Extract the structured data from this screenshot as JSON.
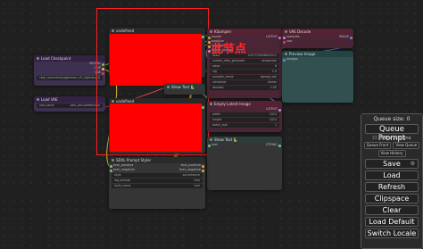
{
  "nodes": {
    "load_checkpoint": {
      "title": "Load Checkpoint",
      "outputs": [
        "MODEL",
        "CLIP",
        "VAE"
      ],
      "ckpt_label": "ckpt_name",
      "ckpt_value": "sdxl\\juggernaut_v9_Lightning_fp16.safetensors"
    },
    "load_vae": {
      "title": "Load VAE",
      "output": "VAE",
      "vae_label": "vae_name",
      "vae_value": "sdxl_vae.safetensors"
    },
    "undefined_top": {
      "title": "undefined",
      "output": "STRING"
    },
    "undefined_bottom": {
      "title": "undefined",
      "output": "STRING"
    },
    "ksampler": {
      "title": "KSampler",
      "inputs": [
        "model",
        "positive",
        "negative",
        "latent_image"
      ],
      "output": "LATENT",
      "widgets": [
        {
          "label": "seed",
          "value": "1027378458832011"
        },
        {
          "label": "control_after_generate",
          "value": "randomize"
        },
        {
          "label": "steps",
          "value": "6"
        },
        {
          "label": "cfg",
          "value": "1.5"
        },
        {
          "label": "sampler_name",
          "value": "dpmpp_sde"
        },
        {
          "label": "scheduler",
          "value": "karras"
        },
        {
          "label": "denoise",
          "value": "1.00"
        }
      ]
    },
    "vae_decode": {
      "title": "VAE Decode",
      "inputs": [
        "samples",
        "vae"
      ],
      "output": "IMAGE"
    },
    "preview_image": {
      "title": "Preview Image",
      "input": "images"
    },
    "show_text_1": {
      "title": "Show Text 🐍",
      "input": "text",
      "output": "STRING"
    },
    "empty_latent": {
      "title": "Empty Latent Image",
      "output": "LATENT",
      "widgets": [
        {
          "label": "width",
          "value": "1024"
        },
        {
          "label": "height",
          "value": "1024"
        },
        {
          "label": "batch_size",
          "value": "1"
        }
      ]
    },
    "show_text_2": {
      "title": "Show Text 🐍",
      "input": "text",
      "output": "STRING"
    },
    "sdxl_prompt": {
      "title": "SDXL Prompt Styler",
      "inputs": [
        "text_positive",
        "text_negative"
      ],
      "outputs": [
        "text_positive",
        "text_negative"
      ],
      "widgets": [
        {
          "label": "style",
          "value": "sai-enhance"
        },
        {
          "label": "log_prompt",
          "value": "true"
        },
        {
          "label": "style_name",
          "value": "true"
        }
      ]
    }
  },
  "annotation": "此节点",
  "panel": {
    "queue_size": "Queue size: 0",
    "queue_prompt": "Queue Prompt",
    "extra_options": "Extra options",
    "queue_front": "Queue Front",
    "view_queue": "View Queue",
    "view_history": "View History",
    "save": "Save",
    "load": "Load",
    "refresh": "Refresh",
    "clipspace": "Clipspace",
    "clear": "Clear",
    "load_default": "Load Default",
    "switch_locale": "Switch Locale"
  },
  "colors": {
    "canvas": "#202020",
    "selection": "#ff2020",
    "image": "#ff0000"
  }
}
